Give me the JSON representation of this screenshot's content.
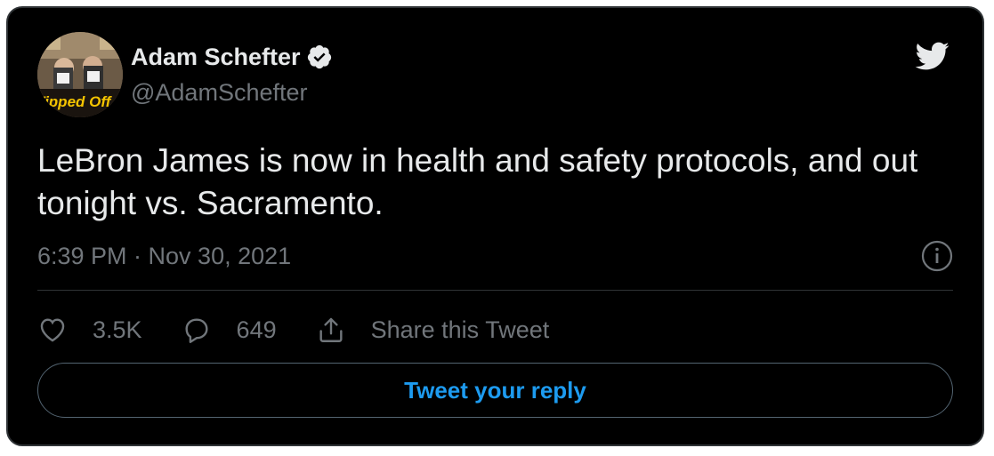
{
  "author": {
    "name": "Adam Schefter",
    "handle": "@AdamSchefter",
    "avatar_caption": "Tipped Off"
  },
  "tweet": {
    "text": "LeBron James is now in health and safety protocols, and out tonight vs. Sacramento.",
    "timestamp": "6:39 PM · Nov 30, 2021"
  },
  "actions": {
    "likes": "3.5K",
    "replies": "649",
    "share_label": "Share this Tweet"
  },
  "reply_button": {
    "label": "Tweet your reply"
  },
  "icons": {
    "brand": "twitter-bird-icon",
    "verified": "verified-badge-icon",
    "info": "info-icon",
    "like": "heart-icon",
    "reply": "speech-bubble-icon",
    "share": "share-icon"
  },
  "colors": {
    "background": "#000000",
    "text": "#e7e9ea",
    "muted": "#71767b",
    "accent": "#1d9bf0",
    "border": "#2f3336"
  }
}
